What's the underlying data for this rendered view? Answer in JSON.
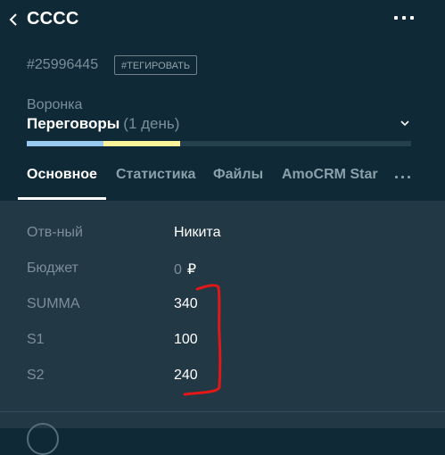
{
  "header": {
    "title": "СССС"
  },
  "meta": {
    "lead_id": "#25996445",
    "tag_button": "#ТЕГИРОВАТЬ"
  },
  "pipeline": {
    "label": "Воронка",
    "stage": "Переговоры",
    "duration": "(1 день)",
    "progress_fraction": 0.4,
    "colors": {
      "passed": "#99c8f0",
      "current": "#fbf49b",
      "track": "#24404d"
    }
  },
  "tabs": [
    {
      "label": "Основное",
      "active": true
    },
    {
      "label": "Статистика",
      "active": false
    },
    {
      "label": "Файлы",
      "active": false
    },
    {
      "label": "AmoCRM Star",
      "active": false
    }
  ],
  "fields": [
    {
      "label": "Отв-ный",
      "value": "Никита"
    },
    {
      "label": "Бюджет",
      "value": "0",
      "currency": "₽"
    },
    {
      "label": "SUMMA",
      "value": "340"
    },
    {
      "label": "S1",
      "value": "100"
    },
    {
      "label": "S2",
      "value": "240"
    }
  ],
  "icons": {
    "back": "chevron-left-icon",
    "menu": "more-horizontal-icon",
    "expand": "chevron-down-icon"
  },
  "annotation_color": "#e01818"
}
